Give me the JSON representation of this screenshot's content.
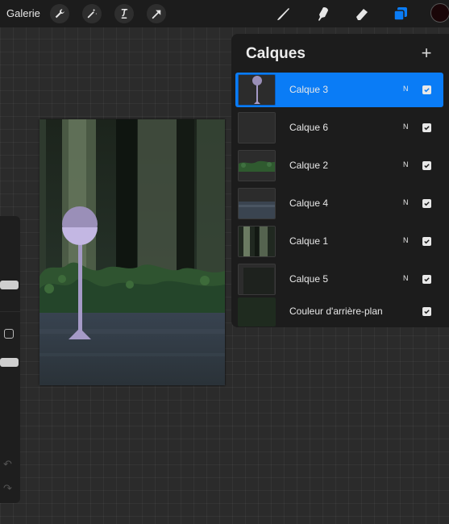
{
  "toolbar": {
    "gallery_label": "Galerie",
    "left_tools": [
      "wrench-icon",
      "magic-wand-icon",
      "selection-icon",
      "transform-arrow-icon"
    ],
    "right_tools": [
      "brush-icon",
      "smudge-icon",
      "eraser-icon",
      "layers-icon"
    ],
    "active_tool": "layers-icon",
    "current_color": "#1a0608"
  },
  "layers_panel": {
    "title": "Calques",
    "add_icon": "plus-icon",
    "layers": [
      {
        "name": "Calque 3",
        "mode": "N",
        "visible": true,
        "selected": true
      },
      {
        "name": "Calque 6",
        "mode": "N",
        "visible": true,
        "selected": false
      },
      {
        "name": "Calque 2",
        "mode": "N",
        "visible": true,
        "selected": false
      },
      {
        "name": "Calque 4",
        "mode": "N",
        "visible": true,
        "selected": false
      },
      {
        "name": "Calque 1",
        "mode": "N",
        "visible": true,
        "selected": false
      },
      {
        "name": "Calque 5",
        "mode": "N",
        "visible": true,
        "selected": false
      }
    ],
    "background_layer": {
      "name": "Couleur d'arrière-plan",
      "visible": true,
      "color": "#1f2b1f"
    }
  },
  "colors": {
    "accent": "#0a7cf6",
    "panel": "#1c1c1c",
    "canvas_bg": "#2b2b2b"
  }
}
